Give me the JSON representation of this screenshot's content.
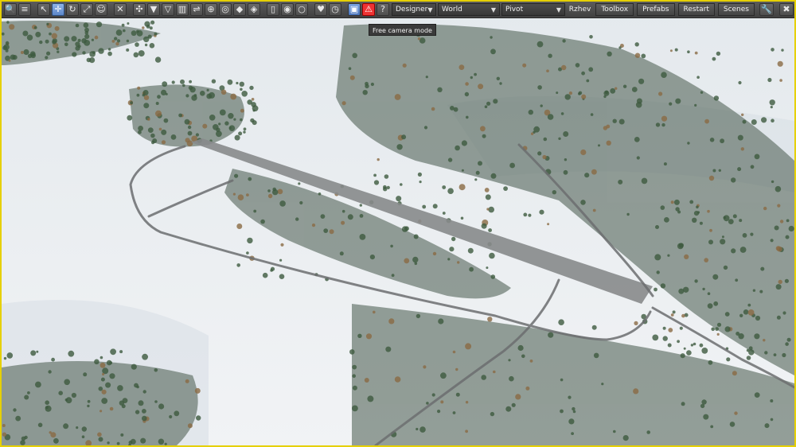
{
  "toolbar": {
    "tools": [
      {
        "icon": "search-icon",
        "glyph": "🔍"
      },
      {
        "icon": "menu-icon",
        "glyph": "≡"
      },
      {
        "icon": "select-cursor-icon",
        "glyph": "↖"
      },
      {
        "icon": "move-icon",
        "glyph": "✛"
      },
      {
        "icon": "rotate-icon",
        "glyph": "↻"
      },
      {
        "icon": "scale-icon",
        "glyph": "⤢"
      },
      {
        "icon": "smile-icon",
        "glyph": "☺"
      },
      {
        "icon": "close-icon",
        "glyph": "✕"
      },
      {
        "icon": "snap-icon",
        "glyph": "✣"
      },
      {
        "icon": "drop-down-icon",
        "glyph": "▼"
      },
      {
        "icon": "drop-outline-icon",
        "glyph": "▽"
      },
      {
        "icon": "align-icon",
        "glyph": "▥"
      },
      {
        "icon": "distribute-icon",
        "glyph": "⇌"
      },
      {
        "icon": "crosshair-icon",
        "glyph": "⊕"
      },
      {
        "icon": "compass-icon",
        "glyph": "◎"
      },
      {
        "icon": "diamond-icon",
        "glyph": "◆"
      },
      {
        "icon": "diamond-outline-icon",
        "glyph": "◈"
      },
      {
        "icon": "document-icon",
        "glyph": "▯"
      },
      {
        "icon": "eye-icon",
        "glyph": "◉"
      },
      {
        "icon": "eye-outline-icon",
        "glyph": "○"
      },
      {
        "icon": "heart-icon",
        "glyph": "♥"
      },
      {
        "icon": "clock-icon",
        "glyph": "◷"
      },
      {
        "icon": "save-icon",
        "glyph": "▣"
      },
      {
        "icon": "warning-icon",
        "glyph": "⚠"
      },
      {
        "icon": "help-icon",
        "glyph": "?"
      }
    ],
    "mode_select": "Designer",
    "space_select": "World",
    "pivot_select": "Pivot",
    "map_name": "Rzhev",
    "toolbox_label": "Toolbox",
    "prefabs_label": "Prefabs",
    "restart_label": "Restart",
    "scenes_label": "Scenes",
    "wrench_glyph": "🔧",
    "close_glyph": "✖"
  },
  "tooltip": {
    "text": "Free camera mode"
  },
  "colors": {
    "frame": "#e6d000",
    "snow": "#eef2f5",
    "tree_green": "#3d5a3e",
    "tree_brown": "#8a6a44",
    "road": "#6c6e70"
  }
}
